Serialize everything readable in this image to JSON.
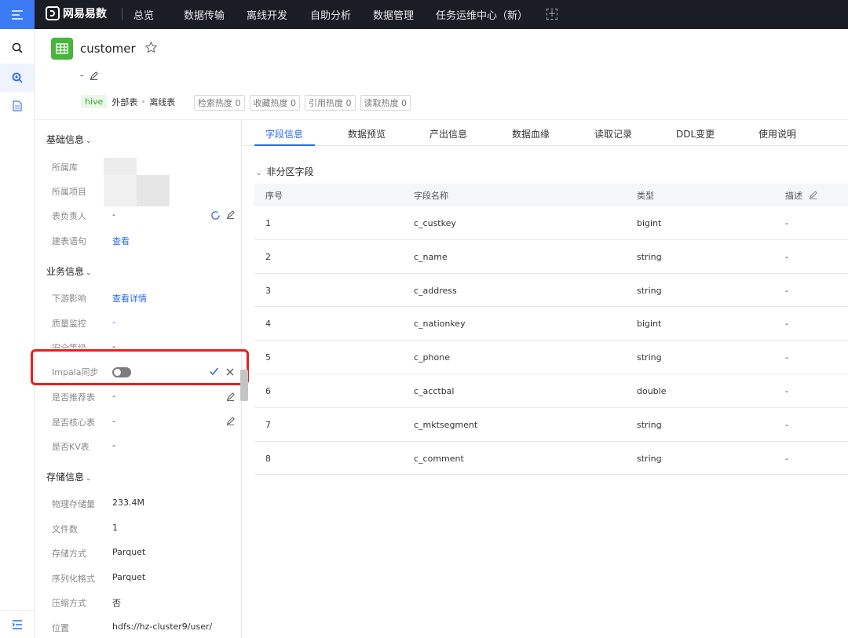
{
  "topnav": {
    "logo_text": "网易易数",
    "items": [
      "总览",
      "数据传输",
      "离线开发",
      "自助分析",
      "数据管理",
      "任务运维中心（新）"
    ],
    "add_symbol": "+"
  },
  "header": {
    "table_name": "customer",
    "description": "-",
    "tags": {
      "engine": "hive",
      "table_type": "外部表",
      "table_kind": "离线表"
    },
    "heat": [
      "检索热度 0",
      "收藏热度 0",
      "引用热度 0",
      "读取热度 0"
    ]
  },
  "left_panel": {
    "basic": {
      "title": "基础信息",
      "rows": {
        "database": {
          "label": "所属库"
        },
        "project": {
          "label": "所属项目"
        },
        "owner": {
          "label": "表负责人",
          "value": "-"
        },
        "ddl": {
          "label": "建表语句",
          "value": "查看"
        }
      }
    },
    "business": {
      "title": "业务信息",
      "rows": {
        "downstream": {
          "label": "下游影响",
          "value": "查看详情"
        },
        "quality": {
          "label": "质量监控",
          "value": "-"
        },
        "security": {
          "label": "安全等级",
          "value": "-"
        },
        "impala": {
          "label": "Impala同步"
        },
        "recommended": {
          "label": "是否推荐表",
          "value": "-"
        },
        "core": {
          "label": "是否核心表",
          "value": "-"
        },
        "kv": {
          "label": "是否KV表",
          "value": "-"
        }
      }
    },
    "storage": {
      "title": "存储信息",
      "rows": {
        "size": {
          "label": "物理存储量",
          "value": "233.4M"
        },
        "files": {
          "label": "文件数",
          "value": "1"
        },
        "format": {
          "label": "存储方式",
          "value": "Parquet"
        },
        "serde": {
          "label": "序列化格式",
          "value": "Parquet"
        },
        "compress": {
          "label": "压缩方式",
          "value": "否"
        },
        "location": {
          "label": "位置",
          "value": "hdfs://hz-cluster9/user/"
        }
      }
    }
  },
  "tabs": [
    "字段信息",
    "数据预览",
    "产出信息",
    "数据血缘",
    "读取记录",
    "DDL变更",
    "使用说明"
  ],
  "fields": {
    "group_title": "非分区字段",
    "columns": [
      "序号",
      "字段名称",
      "类型",
      "描述"
    ],
    "rows": [
      {
        "no": "1",
        "name": "c_custkey",
        "type": "bigint",
        "desc": "-"
      },
      {
        "no": "2",
        "name": "c_name",
        "type": "string",
        "desc": "-"
      },
      {
        "no": "3",
        "name": "c_address",
        "type": "string",
        "desc": "-"
      },
      {
        "no": "4",
        "name": "c_nationkey",
        "type": "bigint",
        "desc": "-"
      },
      {
        "no": "5",
        "name": "c_phone",
        "type": "string",
        "desc": "-"
      },
      {
        "no": "6",
        "name": "c_acctbal",
        "type": "double",
        "desc": "-"
      },
      {
        "no": "7",
        "name": "c_mktsegment",
        "type": "string",
        "desc": "-"
      },
      {
        "no": "8",
        "name": "c_comment",
        "type": "string",
        "desc": "-"
      }
    ]
  },
  "colors": {
    "accent": "#2b6bea",
    "nav_bg": "#1a1d24",
    "highlight": "#e82020",
    "hive_green": "#3aa636"
  }
}
